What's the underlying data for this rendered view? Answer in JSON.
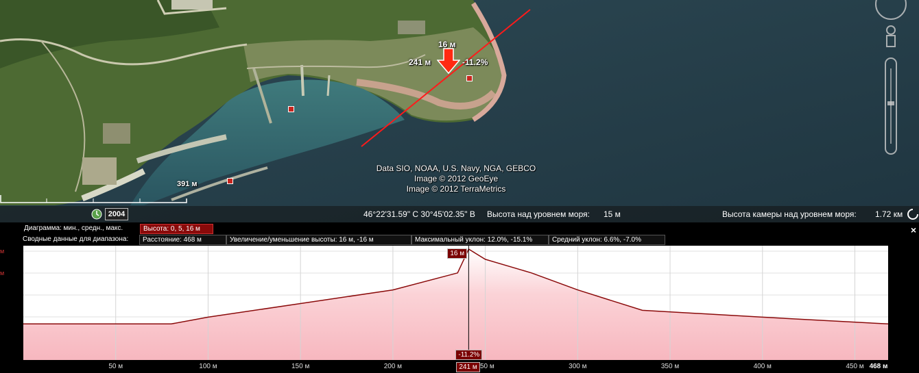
{
  "map": {
    "attribution": [
      "Data SIO, NOAA, U.S. Navy, NGA, GEBCO",
      "Image © 2012 GeoEye",
      "Image © 2012 TerraMetrics"
    ],
    "cursor": {
      "elevation": "16 м",
      "distance": "241 м",
      "slope": "-11.2%"
    },
    "path_length_label": "391 м"
  },
  "statusbar": {
    "year": "2004",
    "coords": "46°22'31.59\" С  30°45'02.35\" В",
    "elev_label": "Высота над уровнем моря:",
    "elev_value": "15 м",
    "cam_label": "Высота камеры над уровнем моря:",
    "cam_value": "1.72 км"
  },
  "profile": {
    "diagram_label": "Диаграмма: мин., средн., макс.",
    "diagram_value": "Высота: 0, 5, 16 м",
    "summary_label": "Сводные данные для диапазона:",
    "distance": "Расстояние: 468 м",
    "gain_loss": "Увеличение/уменьшение высоты: 16 м, -16 м",
    "max_slope": "Максимальный уклон: 12.0%, -15.1%",
    "avg_slope": "Средний уклон: 6.6%, -7.0%",
    "side_labels": [
      "м",
      "м"
    ],
    "cursor_elev": "16 м",
    "cursor_slope": "-11.2%",
    "cursor_dist": "241 м",
    "close": "×"
  },
  "chart_data": {
    "type": "area",
    "xlabel": "",
    "ylabel": "",
    "x_ticks": [
      "50 м",
      "100 м",
      "150 м",
      "200 м",
      "250 м",
      "300 м",
      "350 м",
      "400 м",
      "450 м",
      "468 м"
    ],
    "x": [
      0,
      80,
      100,
      150,
      200,
      235,
      241,
      250,
      275,
      300,
      335,
      400,
      468
    ],
    "y": [
      5,
      5,
      6,
      8,
      10,
      12.5,
      16,
      14.5,
      12.5,
      10,
      7,
      6,
      5
    ],
    "xlim": [
      0,
      468
    ],
    "ylim": [
      0,
      16
    ],
    "color": "#8a0a0a",
    "fill": "#fbd3d7",
    "cursor_x": 241
  }
}
